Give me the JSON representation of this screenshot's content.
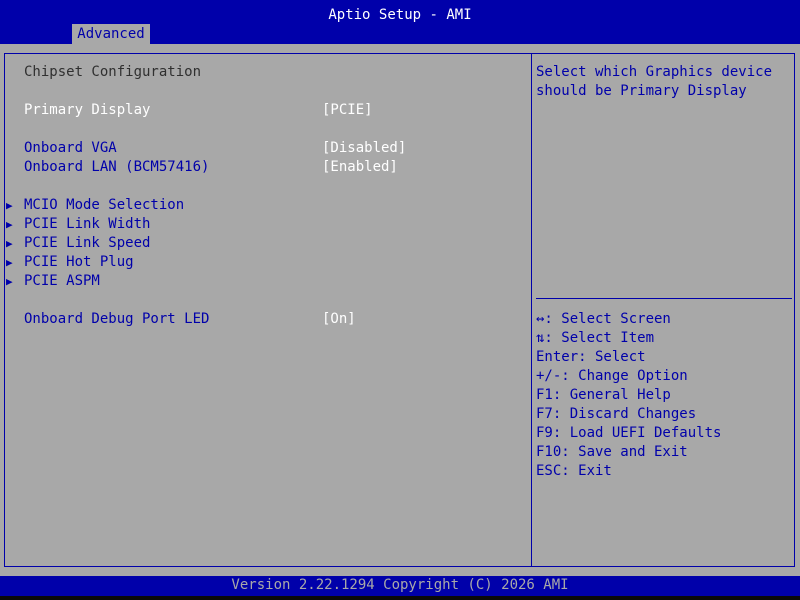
{
  "title": "Aptio Setup - AMI",
  "tab": "Advanced",
  "section_title": "Chipset Configuration",
  "settings": [
    {
      "label": "Primary Display",
      "value": "[PCIE]"
    },
    {
      "label": "Onboard VGA",
      "value": "[Disabled]"
    },
    {
      "label": "Onboard LAN (BCM57416)",
      "value": "[Enabled]"
    },
    {
      "label": "Onboard Debug Port LED",
      "value": "[On]"
    }
  ],
  "submenus": [
    {
      "label": "MCIO Mode Selection"
    },
    {
      "label": "PCIE Link Width"
    },
    {
      "label": "PCIE Link Speed"
    },
    {
      "label": "PCIE Hot Plug"
    },
    {
      "label": "PCIE ASPM"
    }
  ],
  "help": {
    "text": "Select which Graphics device should be Primary Display"
  },
  "keys": [
    "↔: Select Screen",
    "⇅: Select Item",
    "Enter: Select",
    "+/-: Change Option",
    "F1: General Help",
    "F7: Discard Changes",
    "F9: Load UEFI Defaults",
    "F10: Save and Exit",
    "ESC: Exit"
  ],
  "footer": "Version 2.22.1294 Copyright (C) 2026 AMI",
  "colors": {
    "bar": "#0000aa",
    "panel": "#a8a8a8",
    "selected_text": "#ffffff",
    "menu_text": "#0000aa"
  },
  "selected_item": "Primary Display"
}
